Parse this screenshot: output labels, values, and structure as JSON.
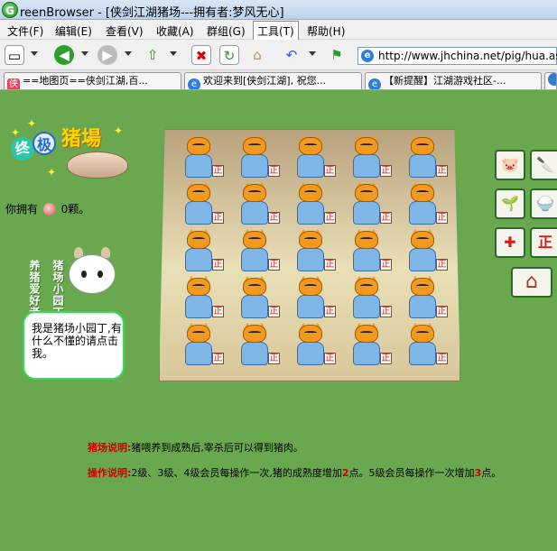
{
  "window": {
    "title": "reenBrowser - [侠剑江湖猪场---拥有者:梦风无心]"
  },
  "menu": [
    {
      "label": "文件(F)"
    },
    {
      "label": "编辑(E)"
    },
    {
      "label": "查看(V)"
    },
    {
      "label": "收藏(A)"
    },
    {
      "label": "群组(G)"
    },
    {
      "label": "工具(T)"
    },
    {
      "label": "帮助(H)"
    }
  ],
  "toolbar": {
    "address": "http://www.jhchina.net/pig/hua.asp"
  },
  "tabs": [
    {
      "icon_text": "侠",
      "label": "==地图页==侠剑江湖,百..."
    },
    {
      "icon_text": "e",
      "label": "欢迎来到[侠剑江湖], 祝您..."
    },
    {
      "icon_text": "e",
      "label": "【新提醒】江湖游戏社区-..."
    }
  ],
  "page": {
    "logo": {
      "ji1": "终",
      "ji2": "极",
      "name": "猪場"
    },
    "own_prefix": "你拥有",
    "own_suffix": "0颗。",
    "helper_left": "养猪爱好者",
    "helper_right": "猪场小园丁",
    "bubble_text": "我是猪场小园丁,有什么不懂的请点击我。",
    "stamp_char": "正",
    "desc1_label": "猪场说明:",
    "desc1_text": "猪喂养到成熟后,宰杀后可以得到猪肉。",
    "desc2_label": "操作说明:",
    "desc2_a": "2级、3级、4级会员每操作一次,猪的成熟度增加",
    "desc2_b": "2",
    "desc2_c": "点。5级会员每操作一次增加",
    "desc2_d": "3",
    "desc2_e": "点。"
  },
  "actions": [
    {
      "name": "feed-pig-button",
      "glyph": "🐷"
    },
    {
      "name": "butcher-button",
      "glyph": "🔪"
    },
    {
      "name": "seed-button",
      "glyph": "🌱"
    },
    {
      "name": "bowl-button",
      "glyph": "🍚"
    },
    {
      "name": "heal-button",
      "glyph": "✚"
    },
    {
      "name": "sign-button",
      "glyph": "正"
    },
    {
      "name": "home-button",
      "glyph": "⌂"
    }
  ]
}
